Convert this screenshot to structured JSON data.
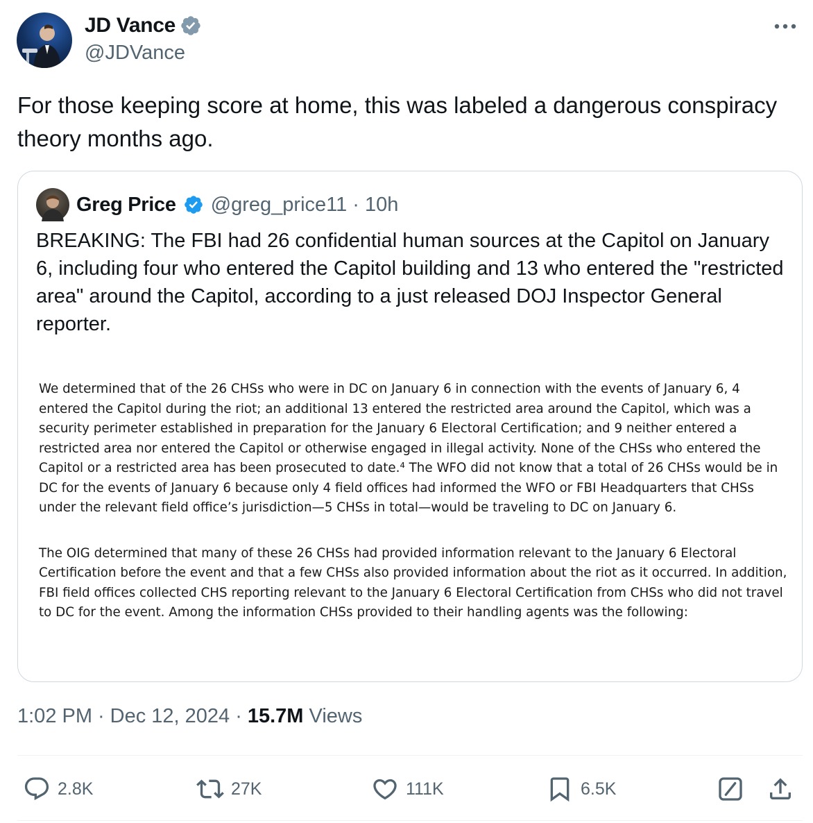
{
  "author": {
    "display_name": "JD Vance",
    "handle": "@JDVance",
    "verified_color": "#829aab"
  },
  "tweet": {
    "text": "For those keeping score at home, this was labeled a dangerous conspiracy theory months ago."
  },
  "quoted": {
    "display_name": "Greg Price",
    "handle": "@greg_price11",
    "separator": "·",
    "age": "10h",
    "verified_color": "#1d9bf0",
    "text": "BREAKING: The FBI had 26 confidential human sources at the Capitol on January 6, including four who entered the Capitol building and 13 who entered the \"restricted area\" around the Capitol, according to a just released DOJ Inspector General reporter.",
    "document": {
      "paragraph1": "We determined that of the 26 CHSs who were in DC on January 6 in connection with the events of January 6, 4 entered the Capitol during the riot; an additional 13 entered the restricted area around the Capitol, which was a security perimeter established in preparation for the January 6 Electoral Certification; and 9 neither entered a restricted area nor entered the Capitol or otherwise engaged in illegal activity.  None of the CHSs who entered the Capitol or a restricted area has been prosecuted to date.⁴  The WFO did not know that a total of 26 CHSs would be in DC for the events of January 6 because only 4 field offices had informed the WFO or FBI Headquarters that CHSs under the relevant field office’s jurisdiction—5 CHSs in total—would be traveling to DC on January 6.",
      "paragraph2": "The OIG determined that many of these 26 CHSs had provided information relevant to the January 6 Electoral Certification before the event and that a few CHSs also provided information about the riot as it occurred.  In addition, FBI field offices collected CHS reporting relevant to the January 6 Electoral Certification from CHSs who did not travel to DC for the event.  Among the information CHSs provided to their handling agents was the following:"
    }
  },
  "meta": {
    "time": "1:02 PM",
    "sep1": "·",
    "date": "Dec 12, 2024",
    "sep2": "·",
    "views_count": "15.7M",
    "views_label": "Views"
  },
  "actions": {
    "replies": "2.8K",
    "reposts": "27K",
    "likes": "111K",
    "bookmarks": "6.5K",
    "icons": [
      "reply-icon",
      "repost-icon",
      "like-icon",
      "bookmark-icon",
      "grok-icon",
      "share-icon"
    ]
  }
}
